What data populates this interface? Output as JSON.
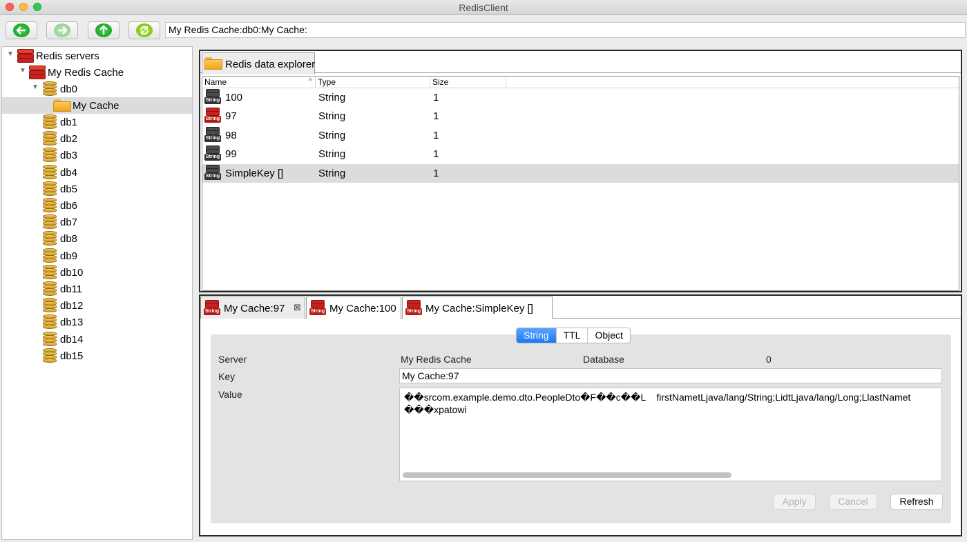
{
  "window": {
    "title": "RedisClient"
  },
  "toolbar": {
    "back_icon": "arrow-left-icon",
    "forward_icon": "arrow-right-icon",
    "up_icon": "arrow-up-icon",
    "refresh_icon": "refresh-icon",
    "address": "My Redis Cache:db0:My Cache:"
  },
  "tree": {
    "root": "Redis servers",
    "server": "My Redis Cache",
    "db0": "db0",
    "folder": "My Cache",
    "dbs": [
      "db1",
      "db2",
      "db3",
      "db4",
      "db5",
      "db6",
      "db7",
      "db8",
      "db9",
      "db10",
      "db11",
      "db12",
      "db13",
      "db14",
      "db15"
    ]
  },
  "explorer": {
    "tab": "Redis data explorer",
    "columns": [
      "Name",
      "Type",
      "Size"
    ],
    "rows": [
      {
        "name": "100",
        "type": "String",
        "size": "1",
        "icon": "grey"
      },
      {
        "name": "97",
        "type": "String",
        "size": "1",
        "icon": "red"
      },
      {
        "name": "98",
        "type": "String",
        "size": "1",
        "icon": "grey"
      },
      {
        "name": "99",
        "type": "String",
        "size": "1",
        "icon": "grey"
      },
      {
        "name": "SimpleKey []",
        "type": "String",
        "size": "1",
        "icon": "grey"
      }
    ],
    "selected_row": 4,
    "string_icon_label": "String"
  },
  "detail": {
    "tabs": [
      "My Cache:97",
      "My Cache:100",
      "My Cache:SimpleKey []"
    ],
    "close_glyph": "⊠",
    "segments": [
      "String",
      "TTL",
      "Object"
    ],
    "active_segment": "String",
    "server_label": "Server",
    "server_value": "My Redis Cache",
    "database_label": "Database",
    "database_value": "0",
    "key_label": "Key",
    "key_value": "My Cache:97",
    "value_label": "Value",
    "value_line1": "��srcom.example.demo.dto.PeopleDto�F��c��L    firstNametLjava/lang/String;LidtLjava/lang/Long;LlastNamet",
    "value_line2": "���xpatowi",
    "buttons": {
      "apply": "Apply",
      "cancel": "Cancel",
      "refresh": "Refresh"
    }
  }
}
